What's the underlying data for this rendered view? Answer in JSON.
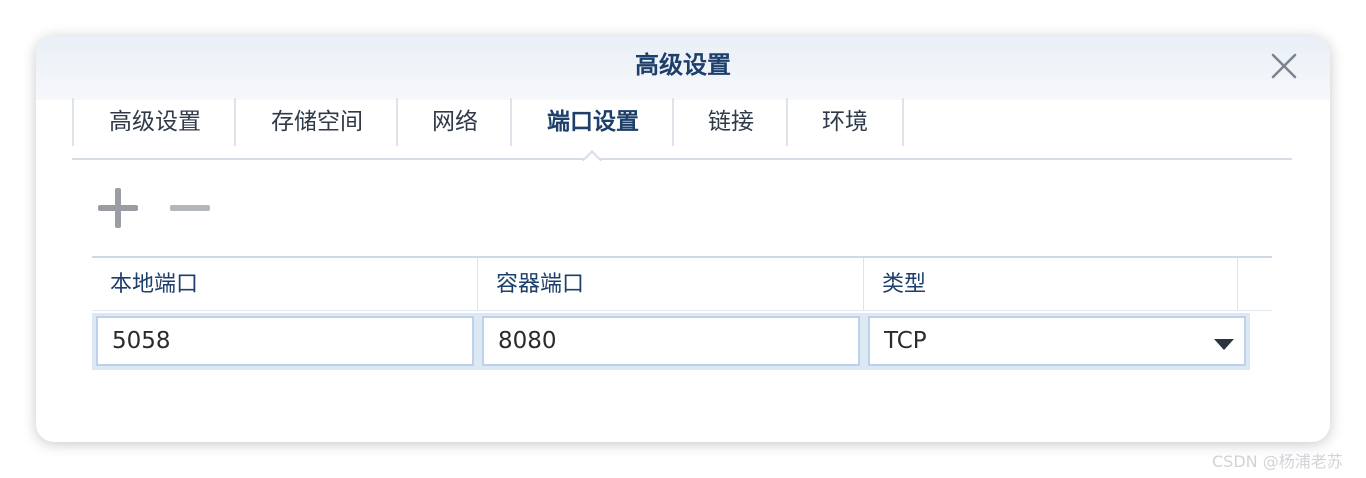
{
  "dialog": {
    "title": "高级设置",
    "close_icon": "close-icon"
  },
  "tabs": [
    {
      "label": "高级设置",
      "active": false
    },
    {
      "label": "存储空间",
      "active": false
    },
    {
      "label": "网络",
      "active": false
    },
    {
      "label": "端口设置",
      "active": true
    },
    {
      "label": "链接",
      "active": false
    },
    {
      "label": "环境",
      "active": false
    }
  ],
  "toolbar": {
    "add_icon": "plus-icon",
    "remove_icon": "minus-icon"
  },
  "port_table": {
    "columns": [
      "本地端口",
      "容器端口",
      "类型"
    ],
    "rows": [
      {
        "local_port": "5058",
        "container_port": "8080",
        "type": "TCP"
      }
    ]
  },
  "watermark": "CSDN @杨浦老苏",
  "colors": {
    "accent": "#1d3f6b",
    "row_highlight": "#dde8f5",
    "input_border": "#bcd1ea"
  }
}
